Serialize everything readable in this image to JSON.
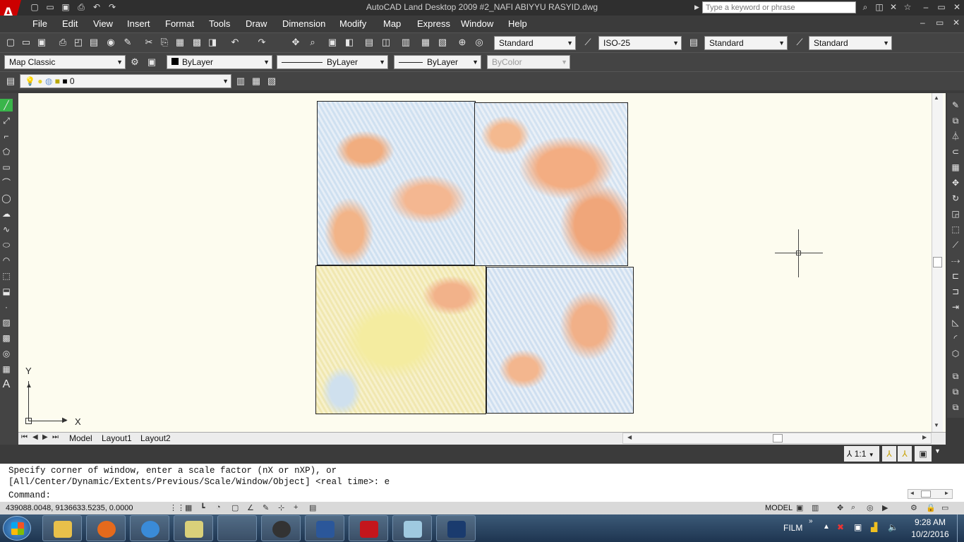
{
  "window": {
    "title": "AutoCAD Land Desktop 2009  #2_NAFI ABIYYU RASYID.dwg",
    "search_placeholder": "Type a keyword or phrase"
  },
  "quick_access": [
    "new-icon",
    "open-icon",
    "save-icon",
    "plot-icon",
    "undo-icon",
    "redo-icon"
  ],
  "window_controls": {
    "minimize": "–",
    "maximize": "▭",
    "close": "✕"
  },
  "doc_controls": {
    "minimize": "–",
    "restore": "▭",
    "close": "✕"
  },
  "menu": [
    "File",
    "Edit",
    "View",
    "Insert",
    "Format",
    "Tools",
    "Draw",
    "Dimension",
    "Modify",
    "Map",
    "Express",
    "Window",
    "Help"
  ],
  "styles": {
    "text_style": "Standard",
    "dim_style": "ISO-25",
    "table_style": "Standard",
    "multileader_style": "Standard"
  },
  "workspace": "Map Classic",
  "properties": {
    "color": "ByLayer",
    "linetype": "ByLayer",
    "lineweight": "ByLayer",
    "plotstyle": "ByColor"
  },
  "layer": {
    "current": "0"
  },
  "ucs": {
    "x_label": "X",
    "y_label": "Y"
  },
  "tabs": [
    "Model",
    "Layout1",
    "Layout2"
  ],
  "annotation_scale": "1:1",
  "command": {
    "line1": "Specify corner of window, enter a scale factor (nX or nXP), or",
    "line2": "[All/Center/Dynamic/Extents/Previous/Scale/Window/Object] <real time>: e",
    "prompt": "Command:"
  },
  "status": {
    "coordinates": "439088.0048, 9136633.5235, 0.0000",
    "model_label": "MODEL"
  },
  "taskbar": {
    "film_label": "FILM",
    "time": "9:28 AM",
    "date": "10/2/2016",
    "apps": [
      "explorer",
      "firefox",
      "chrome",
      "notes",
      "line",
      "autocad-alt",
      "word",
      "acrobat",
      "sticky",
      "autocad-land"
    ],
    "app_colors": [
      "#e8c04a",
      "#e56a1c",
      "#3a8bd8",
      "#d9d07a",
      "#39b54a",
      "#333333",
      "#2b579a",
      "#c4161c",
      "#9fc9e0",
      "#1a3b6e"
    ]
  },
  "colors": {
    "accent": "#c00000",
    "canvas": "#fdfcef",
    "map_orange": "#f2b48a",
    "map_blue": "#c9dcef",
    "map_yellow": "#f2eaa0"
  }
}
